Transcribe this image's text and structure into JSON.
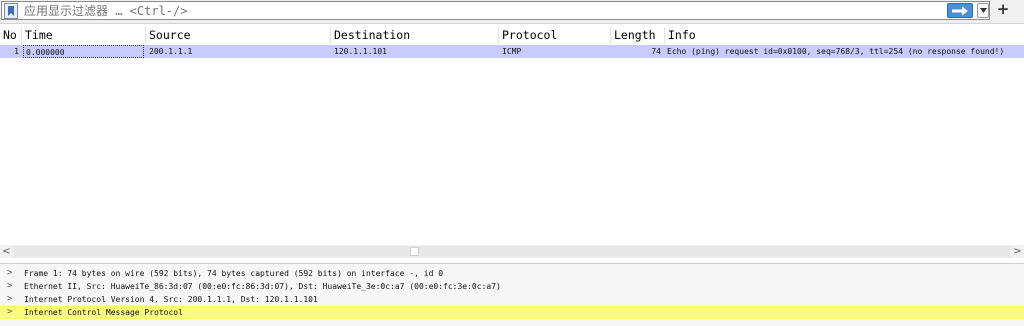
{
  "filter": {
    "placeholder": "应用显示过滤器 … <Ctrl-/>",
    "icons": {
      "bookmark": "bookmark-icon",
      "apply": "arrow-right-icon",
      "dropdown": "chevron-down-icon",
      "add": "plus-icon"
    },
    "add_label": "+"
  },
  "columns": [
    "No",
    "Time",
    "Source",
    "Destination",
    "Protocol",
    "Length",
    "Info"
  ],
  "packets": [
    {
      "no": "1",
      "time": "0.000000",
      "source": "200.1.1.1",
      "destination": "120.1.1.101",
      "protocol": "ICMP",
      "length": "74",
      "info": "Echo (ping) request  id=0x0100, seq=768/3, ttl=254 (no response found!)",
      "row_color": "#c9cbff"
    }
  ],
  "scrollbar": {
    "left_arrow": "<",
    "right_arrow": ">"
  },
  "details": [
    {
      "text": "Frame 1: 74 bytes on wire (592 bits), 74 bytes captured (592 bits) on interface -, id 0",
      "highlight": false
    },
    {
      "text": "Ethernet II, Src: HuaweiTe_86:3d:07 (00:e0:fc:86:3d:07), Dst: HuaweiTe_3e:0c:a7 (00:e0:fc:3e:0c:a7)",
      "highlight": false
    },
    {
      "text": "Internet Protocol Version 4, Src: 200.1.1.1, Dst: 120.1.1.101",
      "highlight": false
    },
    {
      "text": "Internet Control Message Protocol",
      "highlight": true
    }
  ],
  "colors": {
    "selected_row": "#c9cbff",
    "highlight": "#fbfb7d",
    "apply_button": "#4a90d9"
  }
}
